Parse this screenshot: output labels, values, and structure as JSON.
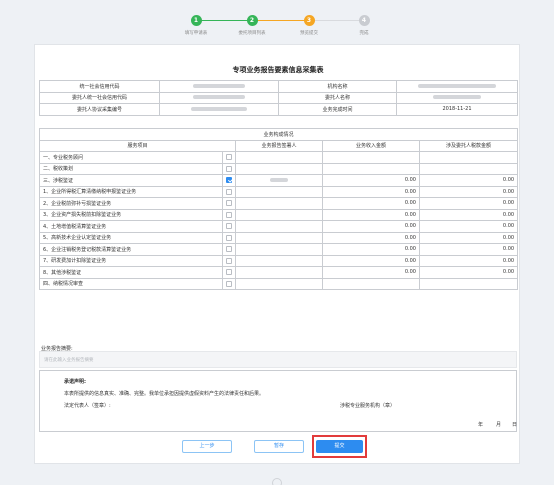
{
  "stepper": {
    "steps": [
      {
        "num": "1",
        "label": "填写申请表"
      },
      {
        "num": "2",
        "label": "委托项目列表"
      },
      {
        "num": "3",
        "label": "预览提交"
      },
      {
        "num": "4",
        "label": "完成"
      }
    ]
  },
  "doc": {
    "title": "专项业务报告要素信息采集表",
    "info": {
      "credit_code_label": "统一社会信用代码",
      "org_name_label": "机构名称",
      "client_credit_label": "委托人统一社会信用代码",
      "client_name_label": "委托人名称",
      "contract_no_label": "委托人协议采集编号",
      "complete_time_label": "业务完成时间",
      "complete_time_value": "2018-11-21"
    },
    "section_title": "业务构成情况",
    "headers": {
      "service": "服务项目",
      "signer": "业务报告签署人",
      "income": "业务收入金额",
      "amount": "涉及委托人税款金额"
    },
    "rows": [
      {
        "name": "一、专业税务顾问",
        "checked": false,
        "income": "",
        "amount": ""
      },
      {
        "name": "二、税收策划",
        "checked": false,
        "income": "",
        "amount": ""
      },
      {
        "name": "三、涉税鉴证",
        "checked": true,
        "income": "0.00",
        "amount": "0.00"
      },
      {
        "name": "1、企业所得税汇算清缴纳税申报鉴证业务",
        "checked": false,
        "income": "0.00",
        "amount": "0.00"
      },
      {
        "name": "2、企业税前弥补亏损鉴证业务",
        "checked": false,
        "income": "0.00",
        "amount": "0.00"
      },
      {
        "name": "3、企业资产损失税前扣除鉴证业务",
        "checked": false,
        "income": "0.00",
        "amount": "0.00"
      },
      {
        "name": "4、土地增值税清算鉴证业务",
        "checked": false,
        "income": "0.00",
        "amount": "0.00"
      },
      {
        "name": "5、高新技术企业认定鉴证业务",
        "checked": false,
        "income": "0.00",
        "amount": "0.00"
      },
      {
        "name": "6、企业注销税务登记税款清算鉴证业务",
        "checked": false,
        "income": "0.00",
        "amount": "0.00"
      },
      {
        "name": "7、研发费加计扣除鉴证业务",
        "checked": false,
        "income": "0.00",
        "amount": "0.00"
      },
      {
        "name": "8、其他涉税鉴证",
        "checked": false,
        "income": "0.00",
        "amount": "0.00"
      },
      {
        "name": "四、纳税情况审查",
        "checked": false,
        "income": "",
        "amount": ""
      }
    ],
    "summary_label": "业务报告摘要:",
    "summary_placeholder": "请在此输入业务报告摘要",
    "declaration": {
      "title": "承诺声明:",
      "body": "本表所提供的信息真实、准确、完整。我单位承担因提供虚假资料产生的法律责任和后果。",
      "rep_label": "法定代表人（签章）:",
      "org_label": "涉税专业服务机构（章）",
      "year": "年",
      "month": "月",
      "day": "日"
    }
  },
  "buttons": {
    "prev": "上一步",
    "save": "暂存",
    "submit": "提交"
  },
  "colors": {
    "done": "#35b558",
    "current": "#f5a623",
    "primary": "#2d8cf0",
    "highlight": "#e23b3b"
  }
}
